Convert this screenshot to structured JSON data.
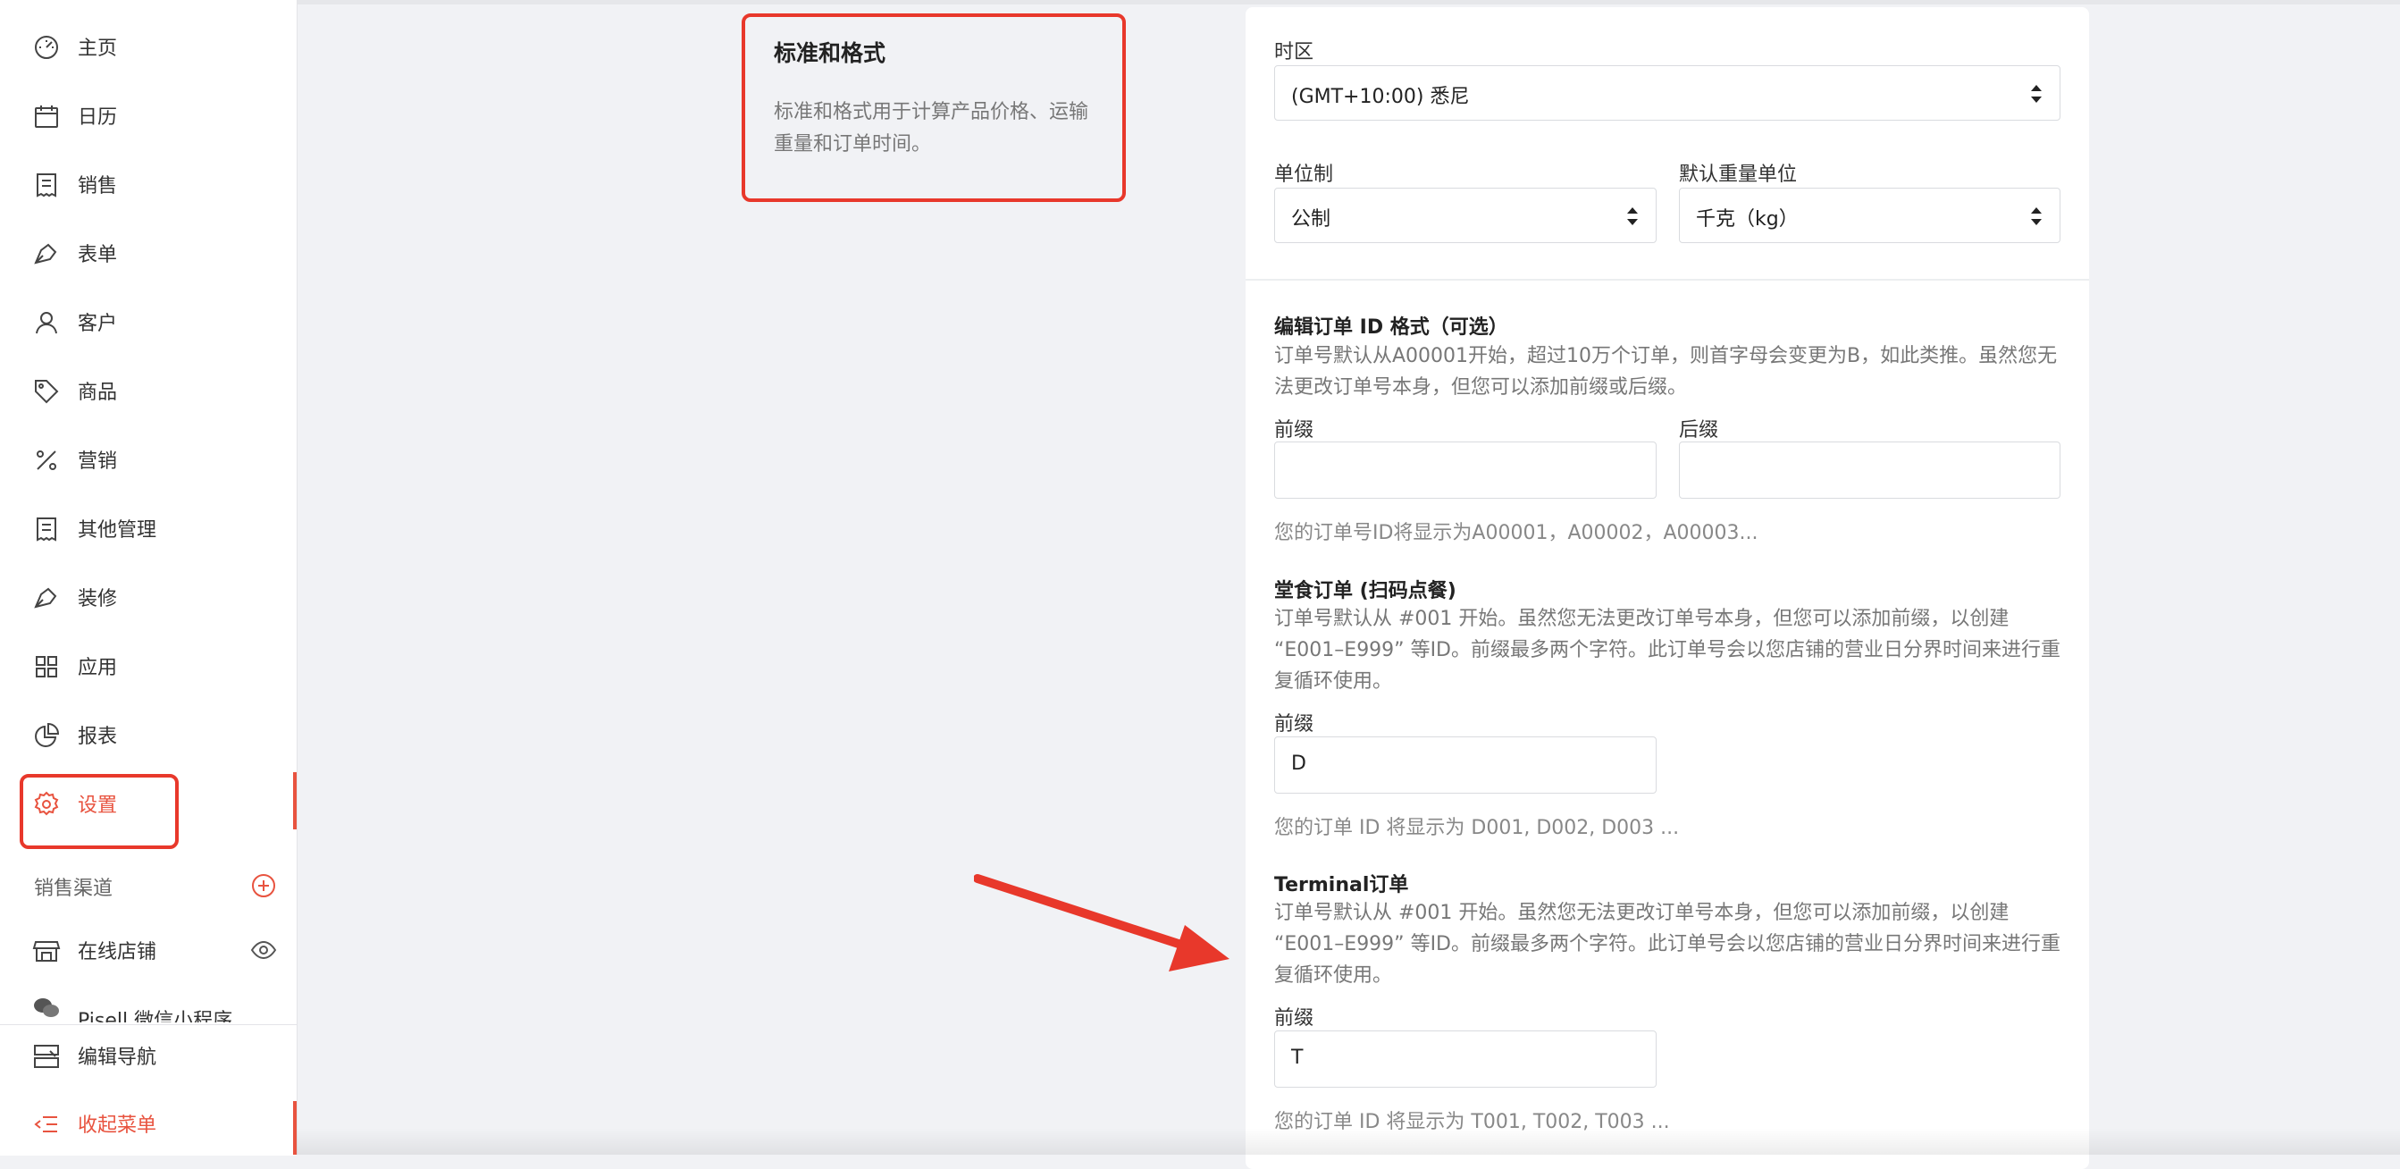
{
  "sidebar": {
    "items": [
      {
        "label": "主页",
        "icon": "dashboard-icon"
      },
      {
        "label": "日历",
        "icon": "calendar-icon"
      },
      {
        "label": "销售",
        "icon": "receipt-icon"
      },
      {
        "label": "表单",
        "icon": "pen-icon"
      },
      {
        "label": "客户",
        "icon": "user-icon"
      },
      {
        "label": "商品",
        "icon": "tag-icon"
      },
      {
        "label": "营销",
        "icon": "percent-icon"
      },
      {
        "label": "其他管理",
        "icon": "receipt-icon"
      },
      {
        "label": "装修",
        "icon": "pen-icon"
      },
      {
        "label": "应用",
        "icon": "apps-icon"
      },
      {
        "label": "报表",
        "icon": "pie-chart-icon"
      },
      {
        "label": "设置",
        "icon": "gear-icon",
        "active": true
      }
    ],
    "channels_title": "销售渠道",
    "online_store": "在线店铺",
    "mini_program": "Pisell 微信小程序",
    "edit_nav": "编辑导航",
    "collapse_menu": "收起菜单"
  },
  "section": {
    "title": "标准和格式",
    "description": "标准和格式用于计算产品价格、运输重量和订单时间。"
  },
  "form": {
    "timezone_label": "时区",
    "timezone_value": "(GMT+10:00) 悉尼",
    "unit_system_label": "单位制",
    "unit_system_value": "公制",
    "weight_unit_label": "默认重量单位",
    "weight_unit_value": "千克（kg）",
    "order_id": {
      "title": "编辑订单 ID 格式（可选）",
      "help": "订单号默认从A00001开始，超过10万个订单，则首字母会变更为B，如此类推。虽然您无法更改订单号本身，但您可以添加前缀或后缀。",
      "prefix_label": "前缀",
      "suffix_label": "后缀",
      "prefix_value": "",
      "suffix_value": "",
      "hint": "您的订单号ID将显示为A00001，A00002，A00003..."
    },
    "dine_in": {
      "title": "堂食订单 (扫码点餐)",
      "help": "订单号默认从 #001 开始。虽然您无法更改订单号本身，但您可以添加前缀，以创建 “E001–E999” 等ID。前缀最多两个字符。此订单号会以您店铺的营业日分界时间来进行重复循环使用。",
      "prefix_label": "前缀",
      "prefix_value": "D",
      "hint": "您的订单 ID 将显示为 D001, D002, D003 ..."
    },
    "terminal": {
      "title": "Terminal订单",
      "help": "订单号默认从 #001 开始。虽然您无法更改订单号本身，但您可以添加前缀，以创建 “E001–E999” 等ID。前缀最多两个字符。此订单号会以您店铺的营业日分界时间来进行重复循环使用。",
      "prefix_label": "前缀",
      "prefix_value": "T",
      "hint": "您的订单 ID 将显示为 T001, T002, T003 ..."
    }
  },
  "colors": {
    "accent": "#e8533f",
    "annotation": "#e8382b"
  }
}
